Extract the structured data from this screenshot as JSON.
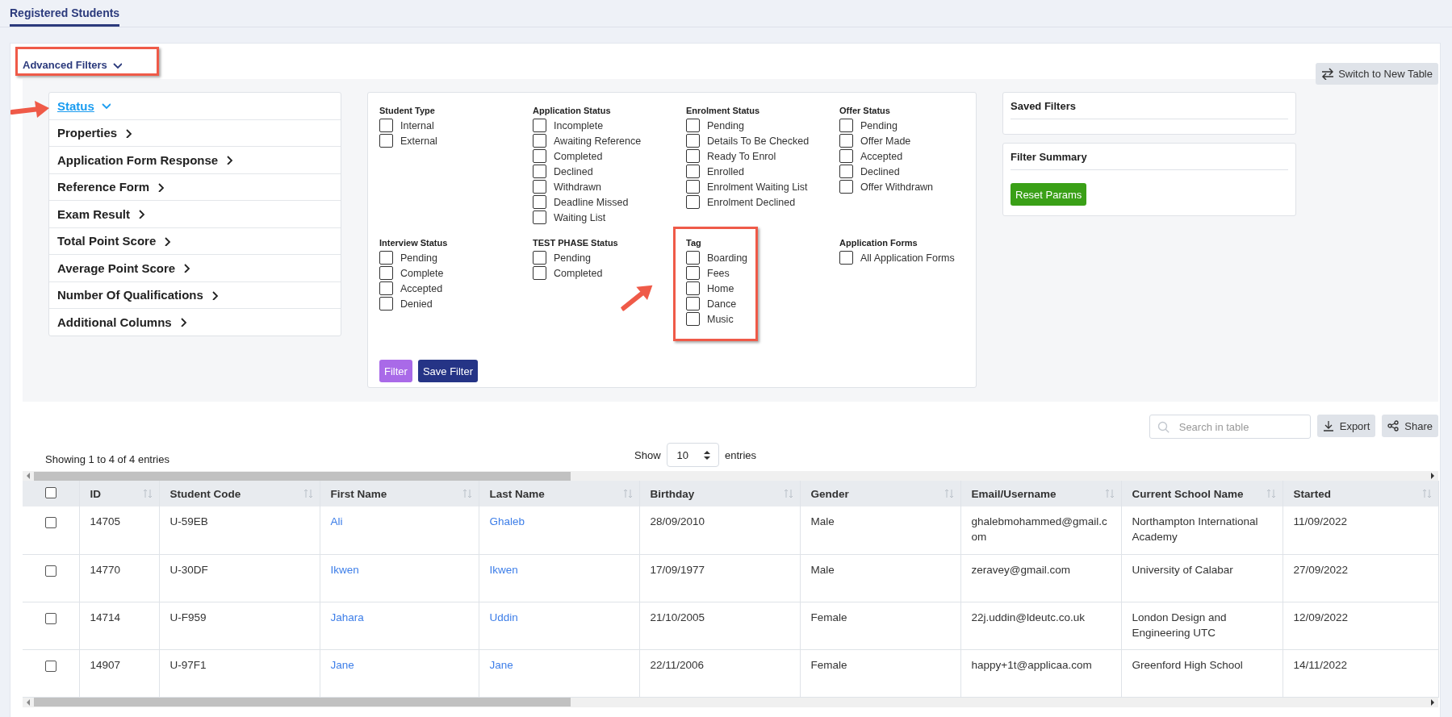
{
  "tabs": [
    {
      "label": "Registered Students",
      "selected": true
    }
  ],
  "advanced_filters": {
    "label": "Advanced Filters",
    "expanded": true,
    "highlighted": true
  },
  "switch_button": {
    "label": "Switch to New Table"
  },
  "filter_categories": [
    {
      "label": "Status",
      "expanded": true,
      "pointed_at": true
    },
    {
      "label": "Properties",
      "expanded": false
    },
    {
      "label": "Application Form Response",
      "expanded": false
    },
    {
      "label": "Reference Form",
      "expanded": false
    },
    {
      "label": "Exam Result",
      "expanded": false
    },
    {
      "label": "Total Point Score",
      "expanded": false
    },
    {
      "label": "Average Point Score",
      "expanded": false
    },
    {
      "label": "Number Of Qualifications",
      "expanded": false
    },
    {
      "label": "Additional Columns",
      "expanded": false
    }
  ],
  "status_groups": [
    {
      "title": "Student Type",
      "options": [
        {
          "label": "Internal",
          "checked": false
        },
        {
          "label": "External",
          "checked": false
        }
      ]
    },
    {
      "title": "Application Status",
      "options": [
        {
          "label": "Incomplete",
          "checked": false
        },
        {
          "label": "Awaiting Reference",
          "checked": false
        },
        {
          "label": "Completed",
          "checked": false
        },
        {
          "label": "Declined",
          "checked": false
        },
        {
          "label": "Withdrawn",
          "checked": false
        },
        {
          "label": "Deadline Missed",
          "checked": false
        },
        {
          "label": "Waiting List",
          "checked": false
        }
      ]
    },
    {
      "title": "Enrolment Status",
      "options": [
        {
          "label": "Pending",
          "checked": false
        },
        {
          "label": "Details To Be Checked",
          "checked": false
        },
        {
          "label": "Ready To Enrol",
          "checked": false
        },
        {
          "label": "Enrolled",
          "checked": false
        },
        {
          "label": "Enrolment Waiting List",
          "checked": false
        },
        {
          "label": "Enrolment Declined",
          "checked": false
        }
      ]
    },
    {
      "title": "Offer Status",
      "options": [
        {
          "label": "Pending",
          "checked": false
        },
        {
          "label": "Offer Made",
          "checked": false
        },
        {
          "label": "Accepted",
          "checked": false
        },
        {
          "label": "Declined",
          "checked": false
        },
        {
          "label": "Offer Withdrawn",
          "checked": false
        }
      ]
    },
    {
      "title": "Interview Status",
      "options": [
        {
          "label": "Pending",
          "checked": false
        },
        {
          "label": "Complete",
          "checked": false
        },
        {
          "label": "Accepted",
          "checked": false
        },
        {
          "label": "Denied",
          "checked": false
        }
      ]
    },
    {
      "title": "TEST PHASE Status",
      "options": [
        {
          "label": "Pending",
          "checked": false
        },
        {
          "label": "Completed",
          "checked": false
        }
      ]
    },
    {
      "title": "Tag",
      "highlighted": true,
      "pointed_at": true,
      "options": [
        {
          "label": "Boarding",
          "checked": false
        },
        {
          "label": "Fees",
          "checked": false
        },
        {
          "label": "Home",
          "checked": false
        },
        {
          "label": "Dance",
          "checked": false
        },
        {
          "label": "Music",
          "checked": false
        }
      ]
    },
    {
      "title": "Application Forms",
      "options": [
        {
          "label": "All Application Forms",
          "checked": false
        }
      ]
    }
  ],
  "filter_buttons": [
    {
      "label": "Filter",
      "kind": "secondary"
    },
    {
      "label": "Save Filter",
      "kind": "primary"
    }
  ],
  "saved_filters": {
    "title": "Saved Filters"
  },
  "filter_summary": {
    "title": "Filter Summary",
    "button": "Reset Params"
  },
  "search": {
    "placeholder": "Search in table"
  },
  "toolbar_buttons": [
    {
      "label": "Export",
      "kind": "export"
    },
    {
      "label": "Share",
      "kind": "share"
    }
  ],
  "info": "Showing 1 to 4 of 4 entries",
  "page_size": {
    "before": "Show",
    "value": "10",
    "after": "entries"
  },
  "table": {
    "select_all_checked": false,
    "columns": [
      "ID",
      "Student Code",
      "First Name",
      "Last Name",
      "Birthday",
      "Gender",
      "Email/Username",
      "Current School Name",
      "Started"
    ],
    "rows": [
      {
        "checked": false,
        "cells": [
          "14705",
          "U-59EB",
          "Ali",
          "Ghaleb",
          "28/09/2010",
          "Male",
          "ghalebmohammed@gmail.com",
          "Northampton International Academy",
          "11/09/2022"
        ]
      },
      {
        "checked": false,
        "cells": [
          "14770",
          "U-30DF",
          "Ikwen",
          "Ikwen",
          "17/09/1977",
          "Male",
          "zeravey@gmail.com",
          "University of Calabar",
          "27/09/2022"
        ]
      },
      {
        "checked": false,
        "cells": [
          "14714",
          "U-F959",
          "Jahara",
          "Uddin",
          "21/10/2005",
          "Female",
          "22j.uddin@ldeutc.co.uk",
          "London Design and Engineering UTC",
          "12/09/2022"
        ]
      },
      {
        "checked": false,
        "cells": [
          "14907",
          "U-97F1",
          "Jane",
          "Jane",
          "22/11/2006",
          "Female",
          "happy+1t@applicaa.com",
          "Greenford High School",
          "14/11/2022"
        ]
      }
    ]
  }
}
